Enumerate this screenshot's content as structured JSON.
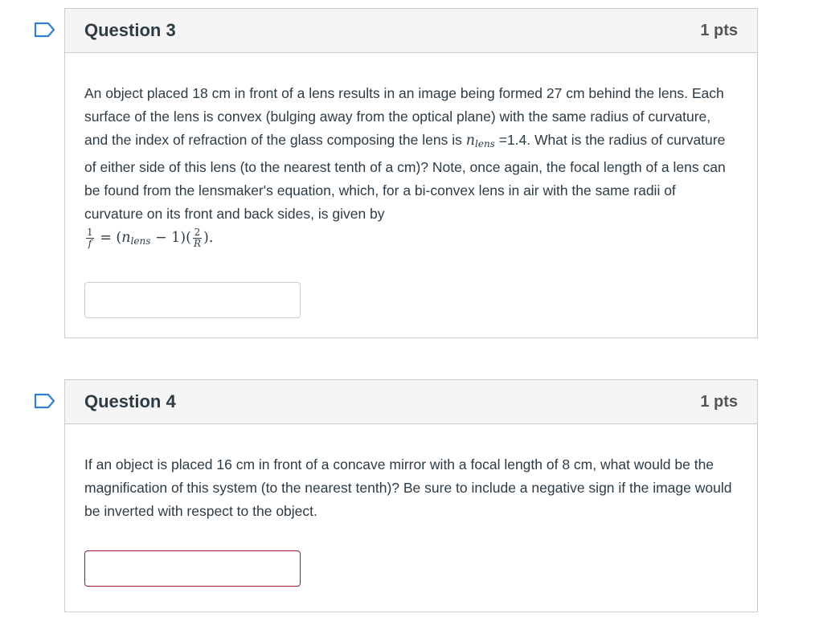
{
  "questions": [
    {
      "title": "Question 3",
      "points": "1 pts",
      "text_part1": "An object placed 18 cm in front of a lens results in an image being formed 27 cm behind the lens.  Each surface of the lens is convex (bulging away from the optical plane) with the same radius of curvature, and the index of refraction of the glass composing the lens is ",
      "n_symbol": "n",
      "n_subscript": "lens",
      "equals_value": "=1.4.",
      "text_part2": " What is the radius of curvature of either side of this lens (to the nearest tenth of a cm)?  Note, once again, the focal length of a lens can be found from the lensmaker's equation, which, for a bi-convex lens in air with the same radii of curvature on its front and  back sides, is given by",
      "formula": {
        "lhs_num": "1",
        "lhs_den": "f",
        "equals": " = (",
        "n_symbol": "n",
        "n_subscript": "lens",
        "minus_one": " − 1)(",
        "rhs_num": "2",
        "rhs_den": "R",
        "close": ")."
      },
      "answer_value": ""
    },
    {
      "title": "Question 4",
      "points": "1 pts",
      "text": "If an object is placed 16 cm in front of a concave mirror with a focal length of 8 cm, what would be the magnification of this system (to the nearest tenth)?  Be sure to include a negative sign if the image would be inverted with respect to the object.",
      "answer_value": ""
    }
  ],
  "colors": {
    "flag": "#2d7fd3",
    "border": "#c7cdd1",
    "header_bg": "#f5f5f5",
    "active_input_border": "#9b1b30"
  }
}
